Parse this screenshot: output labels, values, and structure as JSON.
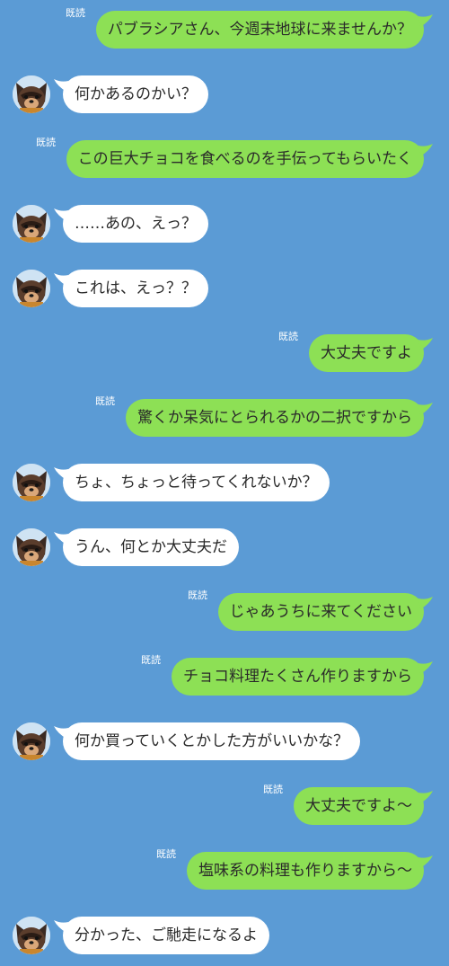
{
  "colors": {
    "background": "#5b9bd5",
    "sent_bubble": "#8de055",
    "received_bubble": "#ffffff"
  },
  "read_label": "既読",
  "messages": [
    {
      "side": "sent",
      "text": "パブラシアさん、今週末地球に来ませんか？"
    },
    {
      "side": "recv",
      "text": "何かあるのかい？"
    },
    {
      "side": "sent",
      "text": "この巨大チョコを食べるのを手伝ってもらいたく"
    },
    {
      "side": "recv",
      "text": "……あの、えっ？"
    },
    {
      "side": "recv",
      "text": "これは、えっ？？"
    },
    {
      "side": "sent",
      "text": "大丈夫ですよ"
    },
    {
      "side": "sent",
      "text": "驚くか呆気にとられるかの二択ですから"
    },
    {
      "side": "recv",
      "text": "ちょ、ちょっと待ってくれないか？"
    },
    {
      "side": "recv",
      "text": "うん、何とか大丈夫だ"
    },
    {
      "side": "sent",
      "text": "じゃあうちに来てください"
    },
    {
      "side": "sent",
      "text": "チョコ料理たくさん作りますから"
    },
    {
      "side": "recv",
      "text": "何か買っていくとかした方がいいかな？"
    },
    {
      "side": "sent",
      "text": "大丈夫ですよ〜"
    },
    {
      "side": "sent",
      "text": "塩味系の料理も作りますから〜"
    },
    {
      "side": "recv",
      "text": "分かった、ご馳走になるよ"
    }
  ]
}
